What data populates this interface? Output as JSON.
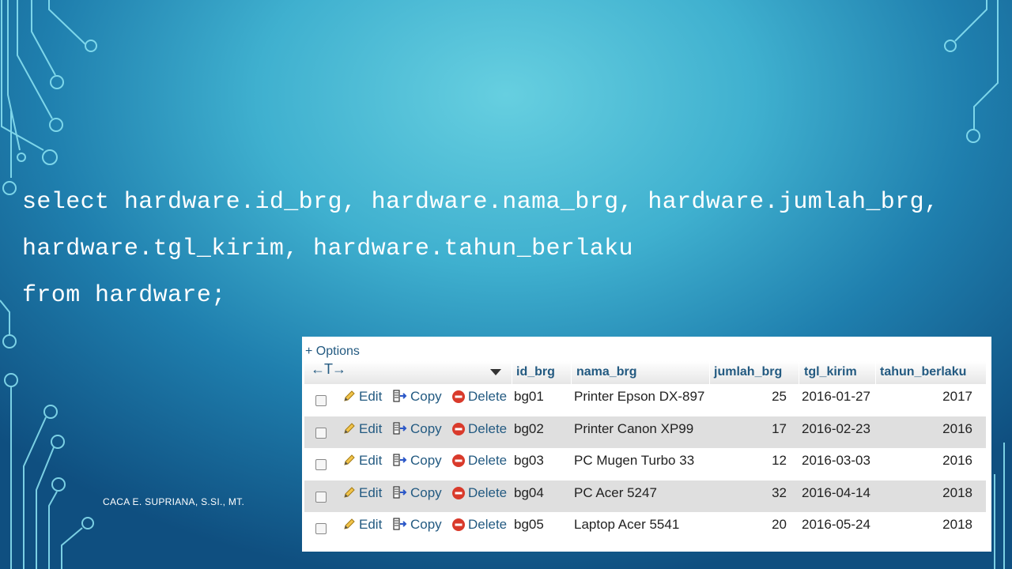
{
  "sql": {
    "line1": "select hardware.id_brg, hardware.nama_brg, hardware.jumlah_brg,",
    "line2": "hardware.tgl_kirim, hardware.tahun_berlaku",
    "line3": "from hardware;"
  },
  "author": "CACA E. SUPRIANA, S.SI., MT.",
  "table": {
    "options_label": "+ Options",
    "arrows_label": "←T→",
    "columns": [
      "id_brg",
      "nama_brg",
      "jumlah_brg",
      "tgl_kirim",
      "tahun_berlaku"
    ],
    "actions": {
      "edit": "Edit",
      "copy": "Copy",
      "delete": "Delete"
    },
    "rows": [
      [
        "bg01",
        "Printer Epson DX-897",
        "25",
        "2016-01-27",
        "2017"
      ],
      [
        "bg02",
        "Printer Canon XP99",
        "17",
        "2016-02-23",
        "2016"
      ],
      [
        "bg03",
        "PC Mugen Turbo 33",
        "12",
        "2016-03-03",
        "2016"
      ],
      [
        "bg04",
        "PC Acer 5247",
        "32",
        "2016-04-14",
        "2018"
      ],
      [
        "bg05",
        "Laptop Acer 5541",
        "20",
        "2016-05-24",
        "2018"
      ]
    ]
  },
  "icons": {
    "edit": "pencil-icon",
    "copy": "copy-icon",
    "delete": "delete-icon",
    "sort": "sort-triangle-icon"
  },
  "colors": {
    "link": "#235a81",
    "row_alt": "#dfdfdf",
    "circuit": "#8ee6f5"
  }
}
